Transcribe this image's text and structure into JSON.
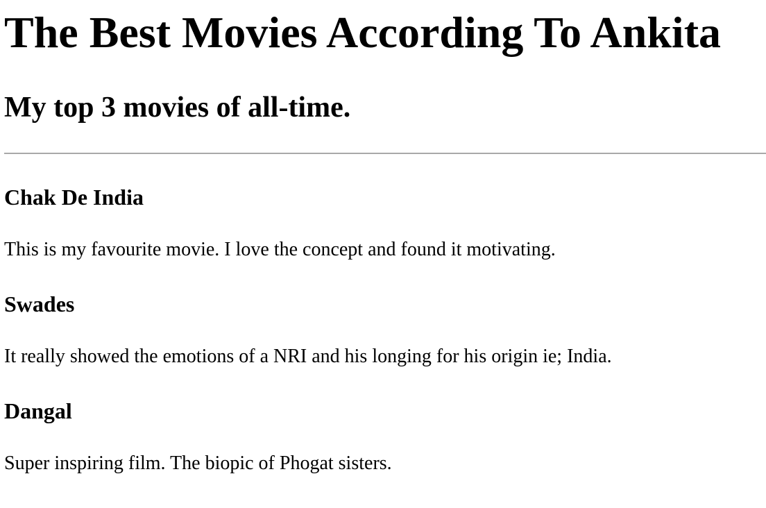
{
  "page": {
    "title": "The Best Movies According To Ankita",
    "subtitle": "My top 3 movies of all-time."
  },
  "movies": [
    {
      "title": "Chak De India",
      "description": "This is my favourite movie. I love the concept and found it motivating."
    },
    {
      "title": "Swades",
      "description": "It really showed the emotions of a NRI and his longing for his origin ie; India."
    },
    {
      "title": "Dangal",
      "description": "Super inspiring film. The biopic of Phogat sisters."
    }
  ]
}
